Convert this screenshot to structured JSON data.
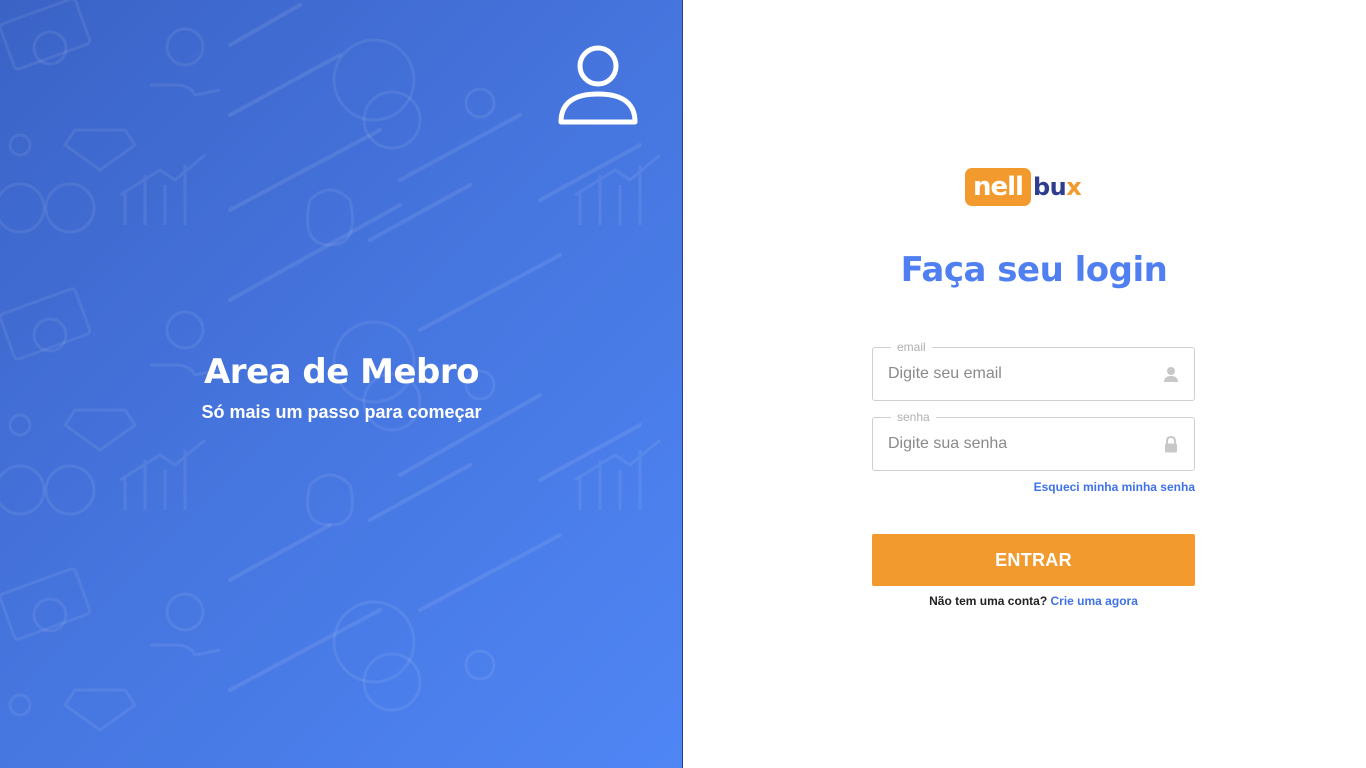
{
  "welcome": {
    "title": "Area de Mebro",
    "subtitle": "Só mais um passo para começar",
    "icon": "user-icon"
  },
  "logo": {
    "part1": "nell",
    "part2": "bu",
    "part3": "x"
  },
  "login": {
    "title": "Faça seu login",
    "email": {
      "label": "email",
      "placeholder": "Digite seu email",
      "value": "",
      "icon": "user-icon"
    },
    "password": {
      "label": "senha",
      "placeholder": "Digite sua senha",
      "value": "",
      "icon": "lock-icon"
    },
    "forgot_label": "Esqueci minha minha senha",
    "submit_label": "ENTRAR",
    "signup_prompt": "Não tem uma conta?",
    "signup_link": "Crie uma agora"
  },
  "colors": {
    "primary_blue": "#4f7ff0",
    "accent_orange": "#f39a2e",
    "logo_navy": "#2f3d8e"
  }
}
